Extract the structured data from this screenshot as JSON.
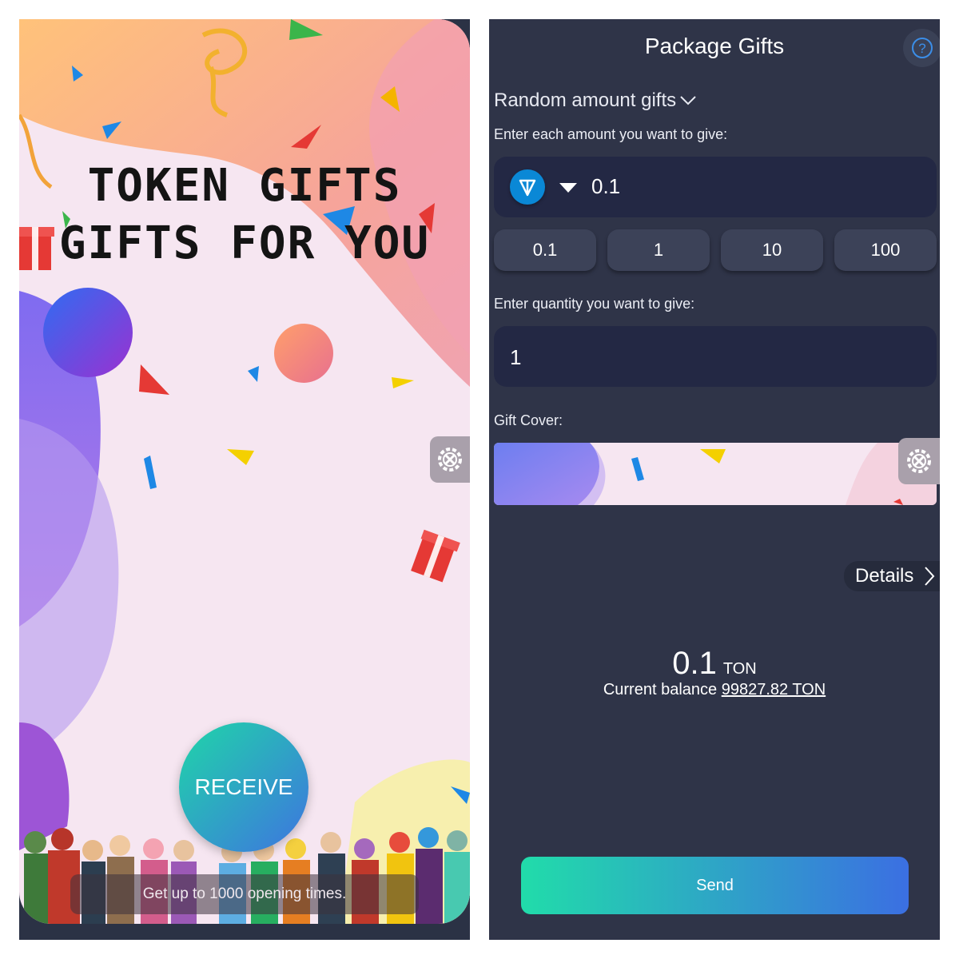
{
  "gift_card": {
    "title_line1": "TOKEN GIFTS",
    "title_line2": "GIFTS FOR YOU",
    "receive_label": "RECEIVE",
    "hint_text": "Get up to 1000 opening times."
  },
  "form": {
    "page_title": "Package Gifts",
    "gift_type": "Random amount gifts",
    "amount_label": "Enter each amount you want to give:",
    "amount_value": "0.1",
    "token_icon": "ton-icon",
    "preset_amounts": [
      "0.1",
      "1",
      "10",
      "100"
    ],
    "quantity_label": "Enter quantity you want to give:",
    "quantity_value": "1",
    "cover_label": "Gift Cover:",
    "details_label": "Details",
    "total_value": "0.1",
    "total_unit": "TON",
    "balance_prefix": "Current balance",
    "balance_value": "99827.82 TON",
    "send_label": "Send"
  },
  "colors": {
    "panel_bg": "#2f3448",
    "input_bg": "#232844",
    "accent_gradient_start": "#21dcaa",
    "accent_gradient_end": "#3b6fe2",
    "ton_blue": "#0a88d6"
  }
}
